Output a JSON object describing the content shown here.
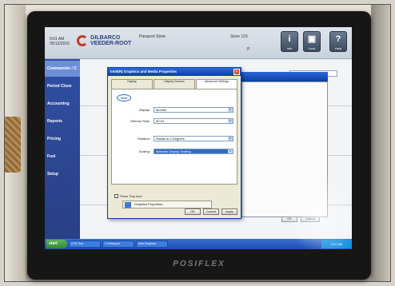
{
  "photo": {
    "monitor_brand": "POSIFLEX"
  },
  "header": {
    "time_line1": "9:01 AM",
    "time_line2": "05/12/2016",
    "logo_line1": "GILBARCO",
    "logo_line2": "VEEDER-ROOT",
    "info_center": "Passport Store",
    "store_label": "Store 123",
    "search_glyph": "⌕",
    "info_button_label": "Info",
    "lock_button_label": "Lock",
    "help_button_label": "Help"
  },
  "sidenav": {
    "items": [
      {
        "label": "Commander / C",
        "active": true
      },
      {
        "label": "Period Close",
        "active": false
      },
      {
        "label": "Accounting",
        "active": false
      },
      {
        "label": "Reports",
        "active": false
      },
      {
        "label": "Pricing",
        "active": false
      },
      {
        "label": "Fuel",
        "active": false
      },
      {
        "label": "Setup",
        "active": false
      }
    ]
  },
  "main": {
    "search_field": "Search Fuel Grade",
    "button_1": "Apply",
    "button_2": "Reset",
    "link_text": "Advanced",
    "bottom_btn_1": "OK",
    "bottom_btn_2": "Cancel"
  },
  "dialog": {
    "title": "Intel(R) Graphics and Media Properties",
    "close_glyph": "×",
    "tabs": [
      {
        "label": "Display"
      },
      {
        "label": "Display Devices"
      },
      {
        "label": "Advanced Settings"
      }
    ],
    "intel_logo": "intel",
    "rows": [
      {
        "label": "Display:",
        "value": "Monitor"
      },
      {
        "label": "Refresh Rate:",
        "value": "60 Hz"
      },
      {
        "label": "Rotation:",
        "value": "Rotate to 0 Degrees"
      },
      {
        "label": "Scaling:",
        "value": "Maintain Display Scaling"
      }
    ],
    "checkbox_label": "Show Tray Icon",
    "note_text": "Graphics Properties",
    "footer_ok": "OK",
    "footer_cancel": "Cancel",
    "footer_apply": "Apply"
  },
  "taskbar": {
    "start_label": "start",
    "items": [
      {
        "label": "CTS Tool"
      },
      {
        "label": "C:\\Passport"
      },
      {
        "label": "Intel Graphics"
      }
    ],
    "tray_time": "9:01 AM"
  }
}
